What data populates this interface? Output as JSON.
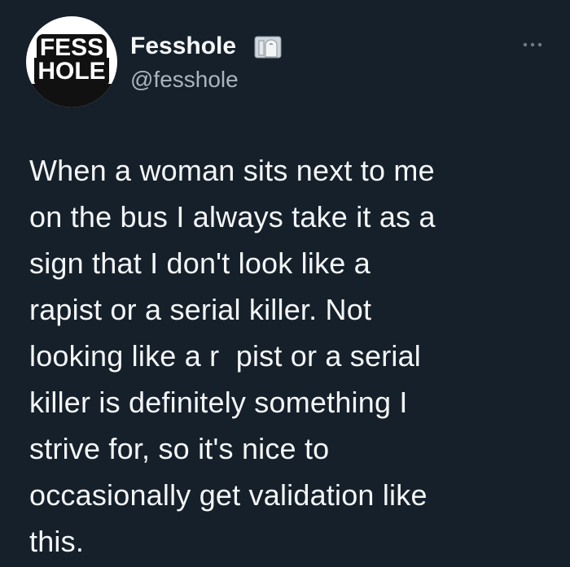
{
  "author": {
    "avatar_text": [
      "FESS",
      "HOLE"
    ],
    "display_name": "Fesshole",
    "handle": "@fesshole",
    "badge_icon": "toilet-paper-icon"
  },
  "actions": {
    "more_icon": "more-dots-icon"
  },
  "tweet": {
    "lines": [
      "When a woman sits next to me",
      "on the bus I always take it as a",
      "sign that I don't look like a",
      "rapist or a serial killer. Not",
      "looking like a r  pist or a serial",
      "killer is definitely something I",
      "strive for, so it's nice to",
      "occasionally get validation like",
      "this."
    ]
  },
  "colors": {
    "background": "#15202b",
    "text": "#f7f9f9",
    "secondary_text": "#a9b4bd"
  }
}
